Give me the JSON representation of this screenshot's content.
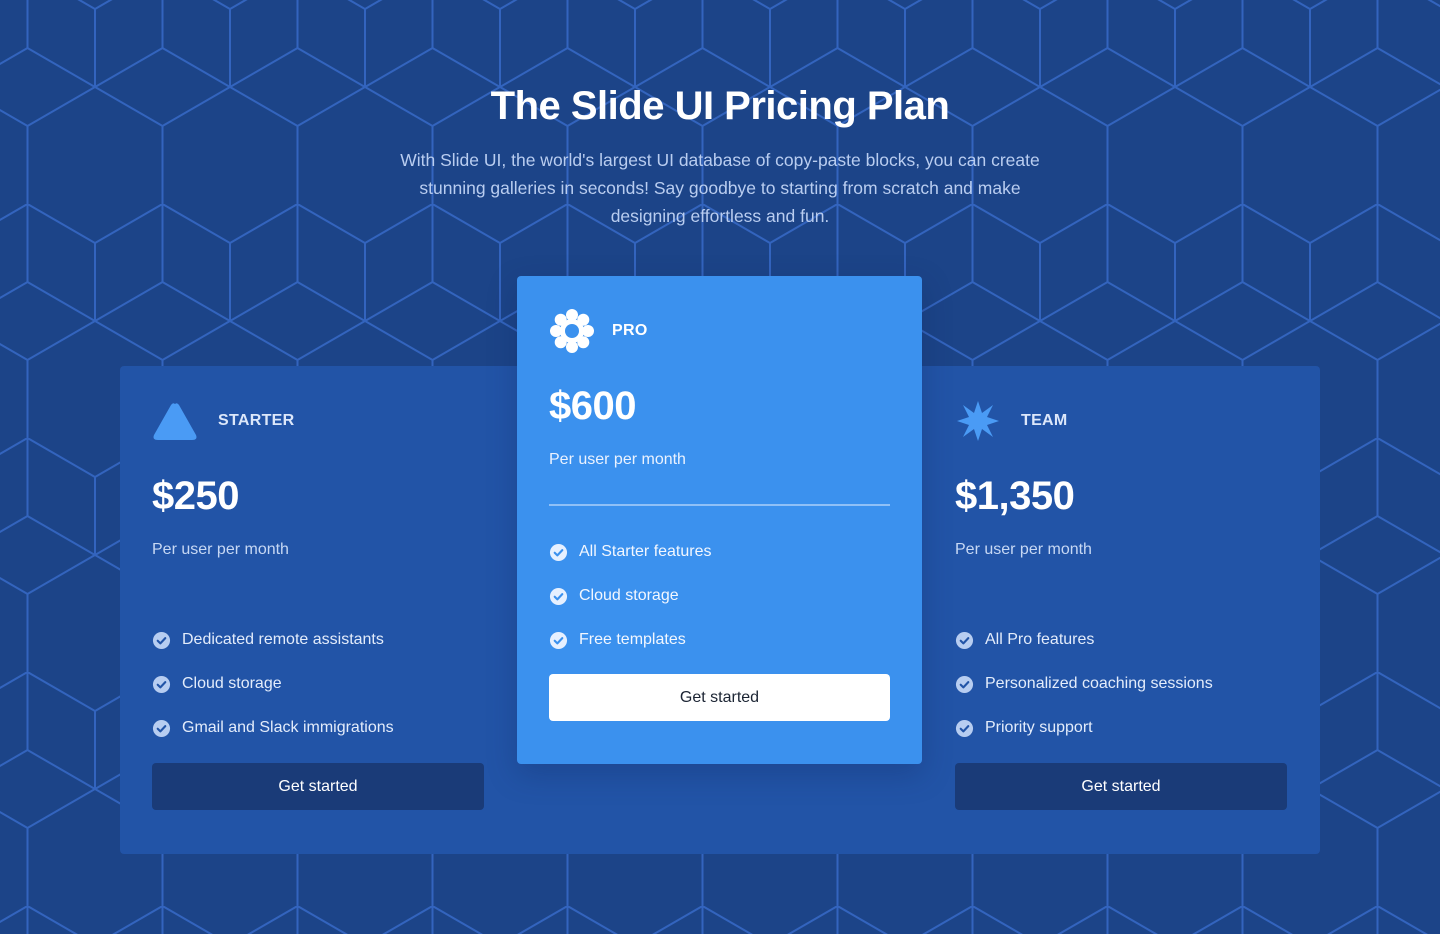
{
  "hero": {
    "title": "The Slide UI Pricing Plan",
    "subtitle": "With Slide UI, the world's largest UI database of copy-paste blocks, you can create stunning galleries in seconds! Say goodbye to starting from scratch and make designing effortless and fun."
  },
  "colors": {
    "background": "#1c4488",
    "panel": "#2254a7",
    "pro_card": "#3b91ee",
    "button_dark": "#1a3b78",
    "icon_blue": "#4a9bf5"
  },
  "plans": {
    "starter": {
      "icon": "triangle-icon",
      "name": "STARTER",
      "price": "$250",
      "period": "Per user per month",
      "features": [
        "Dedicated remote assistants",
        "Cloud storage",
        "Gmail and Slack immigrations"
      ],
      "cta": "Get started"
    },
    "pro": {
      "icon": "flower-icon",
      "name": "PRO",
      "price": "$600",
      "period": "Per user per month",
      "features": [
        "All Starter features",
        "Cloud storage",
        "Free templates"
      ],
      "cta": "Get started"
    },
    "team": {
      "icon": "star-burst-icon",
      "name": "TEAM",
      "price": "$1,350",
      "period": "Per user per month",
      "features": [
        "All Pro features",
        "Personalized coaching sessions",
        "Priority support"
      ],
      "cta": "Get started"
    }
  }
}
